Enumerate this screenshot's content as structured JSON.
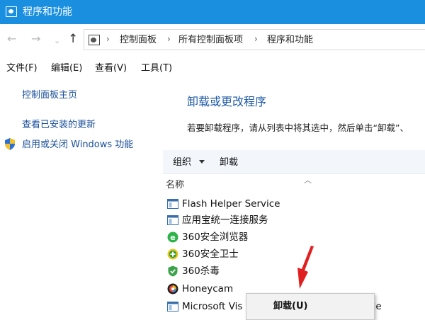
{
  "window": {
    "title": "程序和功能"
  },
  "address": {
    "crumbs": [
      "控制面板",
      "所有控制面板项",
      "程序和功能"
    ]
  },
  "menu": [
    "文件(F)",
    "编辑(E)",
    "查看(V)",
    "工具(T)"
  ],
  "left_pane": {
    "home": "控制面板主页",
    "updates": "查看已安装的更新",
    "features": "启用或关闭 Windows 功能"
  },
  "main": {
    "title": "卸载或更改程序",
    "description": "若要卸载程序，请从列表中将其选中，然后单击“卸载”、"
  },
  "toolbar": {
    "organize": "组织",
    "uninstall": "卸载"
  },
  "list": {
    "column_name": "名称",
    "items": [
      {
        "name": "Flash Helper Service",
        "icon": "window-icon"
      },
      {
        "name": "应用宝统一连接服务",
        "icon": "window-icon"
      },
      {
        "name": "360安全浏览器",
        "icon": "browser-e-icon"
      },
      {
        "name": "360安全卫士",
        "icon": "plus-circle-icon"
      },
      {
        "name": "360杀毒",
        "icon": "shield-icon"
      },
      {
        "name": "Honeycam",
        "icon": "honeycam-icon"
      },
      {
        "name": "Microsoft Vis",
        "suffix": "ble",
        "icon": "window-icon"
      }
    ]
  },
  "context_menu": {
    "uninstall": "卸载(U)"
  },
  "colors": {
    "titlebar": "#1a8fe0",
    "link": "#1a4f9a",
    "heading": "#1e5aa8",
    "selection": "#cce8ff",
    "arrow": "#e02020"
  }
}
